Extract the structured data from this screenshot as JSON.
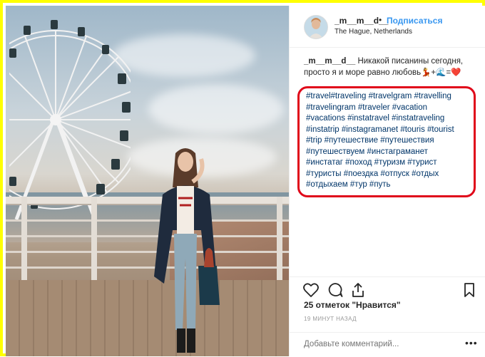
{
  "post": {
    "username": "_m__m__d__",
    "follow_label": "Подписаться",
    "separator": "•",
    "location": "The Hague, Netherlands",
    "caption_user": "_m__m__d__",
    "caption_text": " Никакой писанины сегодня, просто я и море равно любовь",
    "caption_emoji": "💃+🌊=❤️",
    "hashtags": "#travel#traveling #travelgram #travelling #travelingram #traveler #vacation #vacations #instatravel #instatraveling #instatrip #instagramanet #touris #tourist #trip #путешествие #путешествия #путешествуем #инстаграманет #инстатаг #поход #туризм #турист #туристы #поездка #отпуск #отдых #отдыхаем #тур #путь",
    "likes": "25 отметок \"Нравится\"",
    "time": "19 МИНУТ НАЗАД",
    "comment_placeholder": "Добавьте комментарий...",
    "more_label": "•••"
  },
  "colors": {
    "frame": "#ffff00",
    "link": "#3897f0",
    "hashtag": "#003569",
    "highlight": "#e0081a"
  },
  "icons": [
    "heart-icon",
    "comment-icon",
    "share-icon",
    "bookmark-icon"
  ]
}
